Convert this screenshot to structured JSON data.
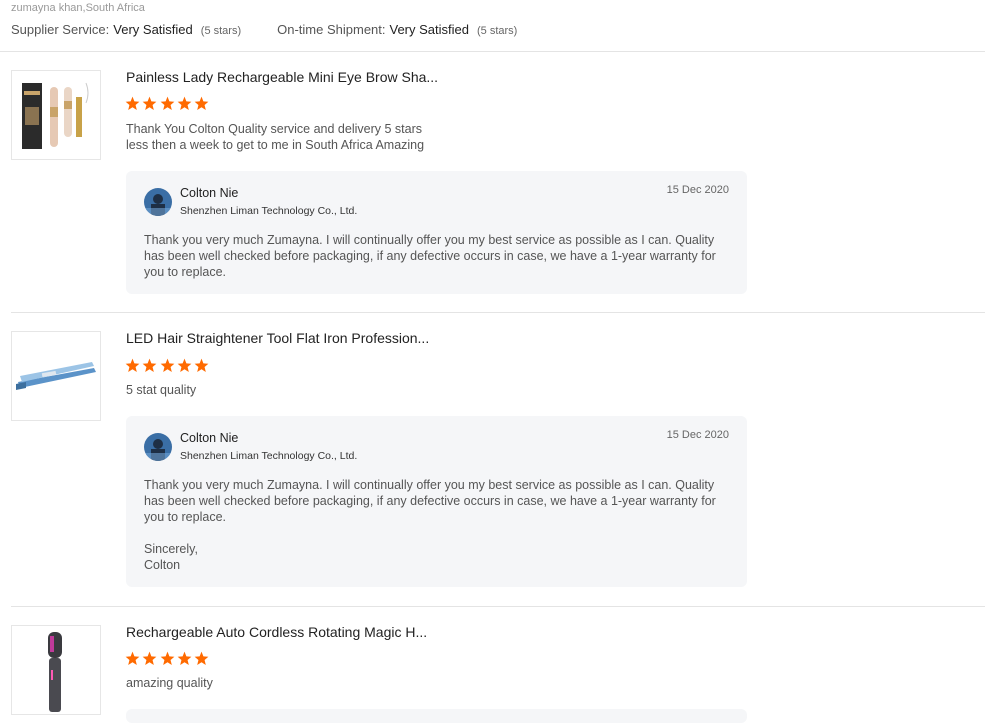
{
  "header": {
    "location": "zumayna khan,South Africa",
    "supplier_service": {
      "label": "Supplier Service:",
      "value": "Very Satisfied",
      "stars": "(5 stars)"
    },
    "shipment": {
      "label": "On-time Shipment:",
      "value": "Very Satisfied",
      "stars": "(5 stars)"
    }
  },
  "colors": {
    "star": "#ff6a00",
    "reply_bg": "#f5f6f8",
    "divider": "#e4e4e4"
  },
  "reviews": [
    {
      "title": "Painless Lady Rechargeable Mini Eye Brow Sha...",
      "rating": 5,
      "comment": [
        "Thank You Colton Quality service and delivery 5 stars",
        "less then a week to get to me in South Africa Amazing"
      ],
      "reply": {
        "name": "Colton Nie",
        "company": "Shenzhen Liman Technology Co., Ltd.",
        "date": "15 Dec 2020",
        "message": [
          "Thank you very much Zumayna. I will continually offer you my best service as possible as I can. Quality has been well checked before packaging, if any defective occurs in case, we have a 1-year warranty for you to replace."
        ]
      }
    },
    {
      "title": "LED Hair Straightener Tool Flat Iron Profession...",
      "rating": 5,
      "comment": [
        "5 stat quality"
      ],
      "reply": {
        "name": "Colton Nie",
        "company": "Shenzhen Liman Technology Co., Ltd.",
        "date": "15 Dec 2020",
        "message": [
          "Thank you very much Zumayna. I will continually offer you my best service as possible as I can. Quality has been well checked before packaging, if any defective occurs in case, we have a 1-year warranty for you to replace.",
          "Sincerely,\nColton"
        ]
      }
    },
    {
      "title": "Rechargeable Auto Cordless Rotating Magic H...",
      "rating": 5,
      "comment": [
        "amazing quality"
      ]
    }
  ]
}
